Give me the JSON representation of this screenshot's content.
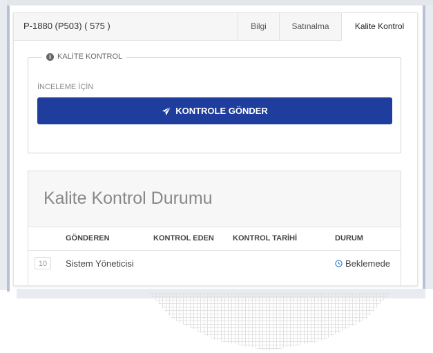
{
  "header": {
    "title": "P-1880 (P503) ( 575 )",
    "tabs": [
      {
        "label": "Bilgi"
      },
      {
        "label": "Satınalma"
      },
      {
        "label": "Kalite Kontrol"
      }
    ]
  },
  "qc_section": {
    "legend": "KALİTE KONTROL",
    "inspect_label": "İNCELEME İÇİN",
    "send_button_label": "KONTROLE GÖNDER",
    "send_icon": "paper-plane-icon",
    "button_color": "#1f3d9c"
  },
  "status_panel": {
    "title": "Kalite Kontrol Durumu",
    "columns": [
      "GÖNDEREN",
      "KONTROL EDEN",
      "KONTROL TARİHİ",
      "DURUM"
    ],
    "rows": [
      {
        "index": "10",
        "sender": "Sistem Yöneticisi",
        "controller": "",
        "date": "",
        "status": "Beklemede",
        "status_icon": "clock-icon",
        "status_color": "#2a7fd4"
      }
    ]
  }
}
